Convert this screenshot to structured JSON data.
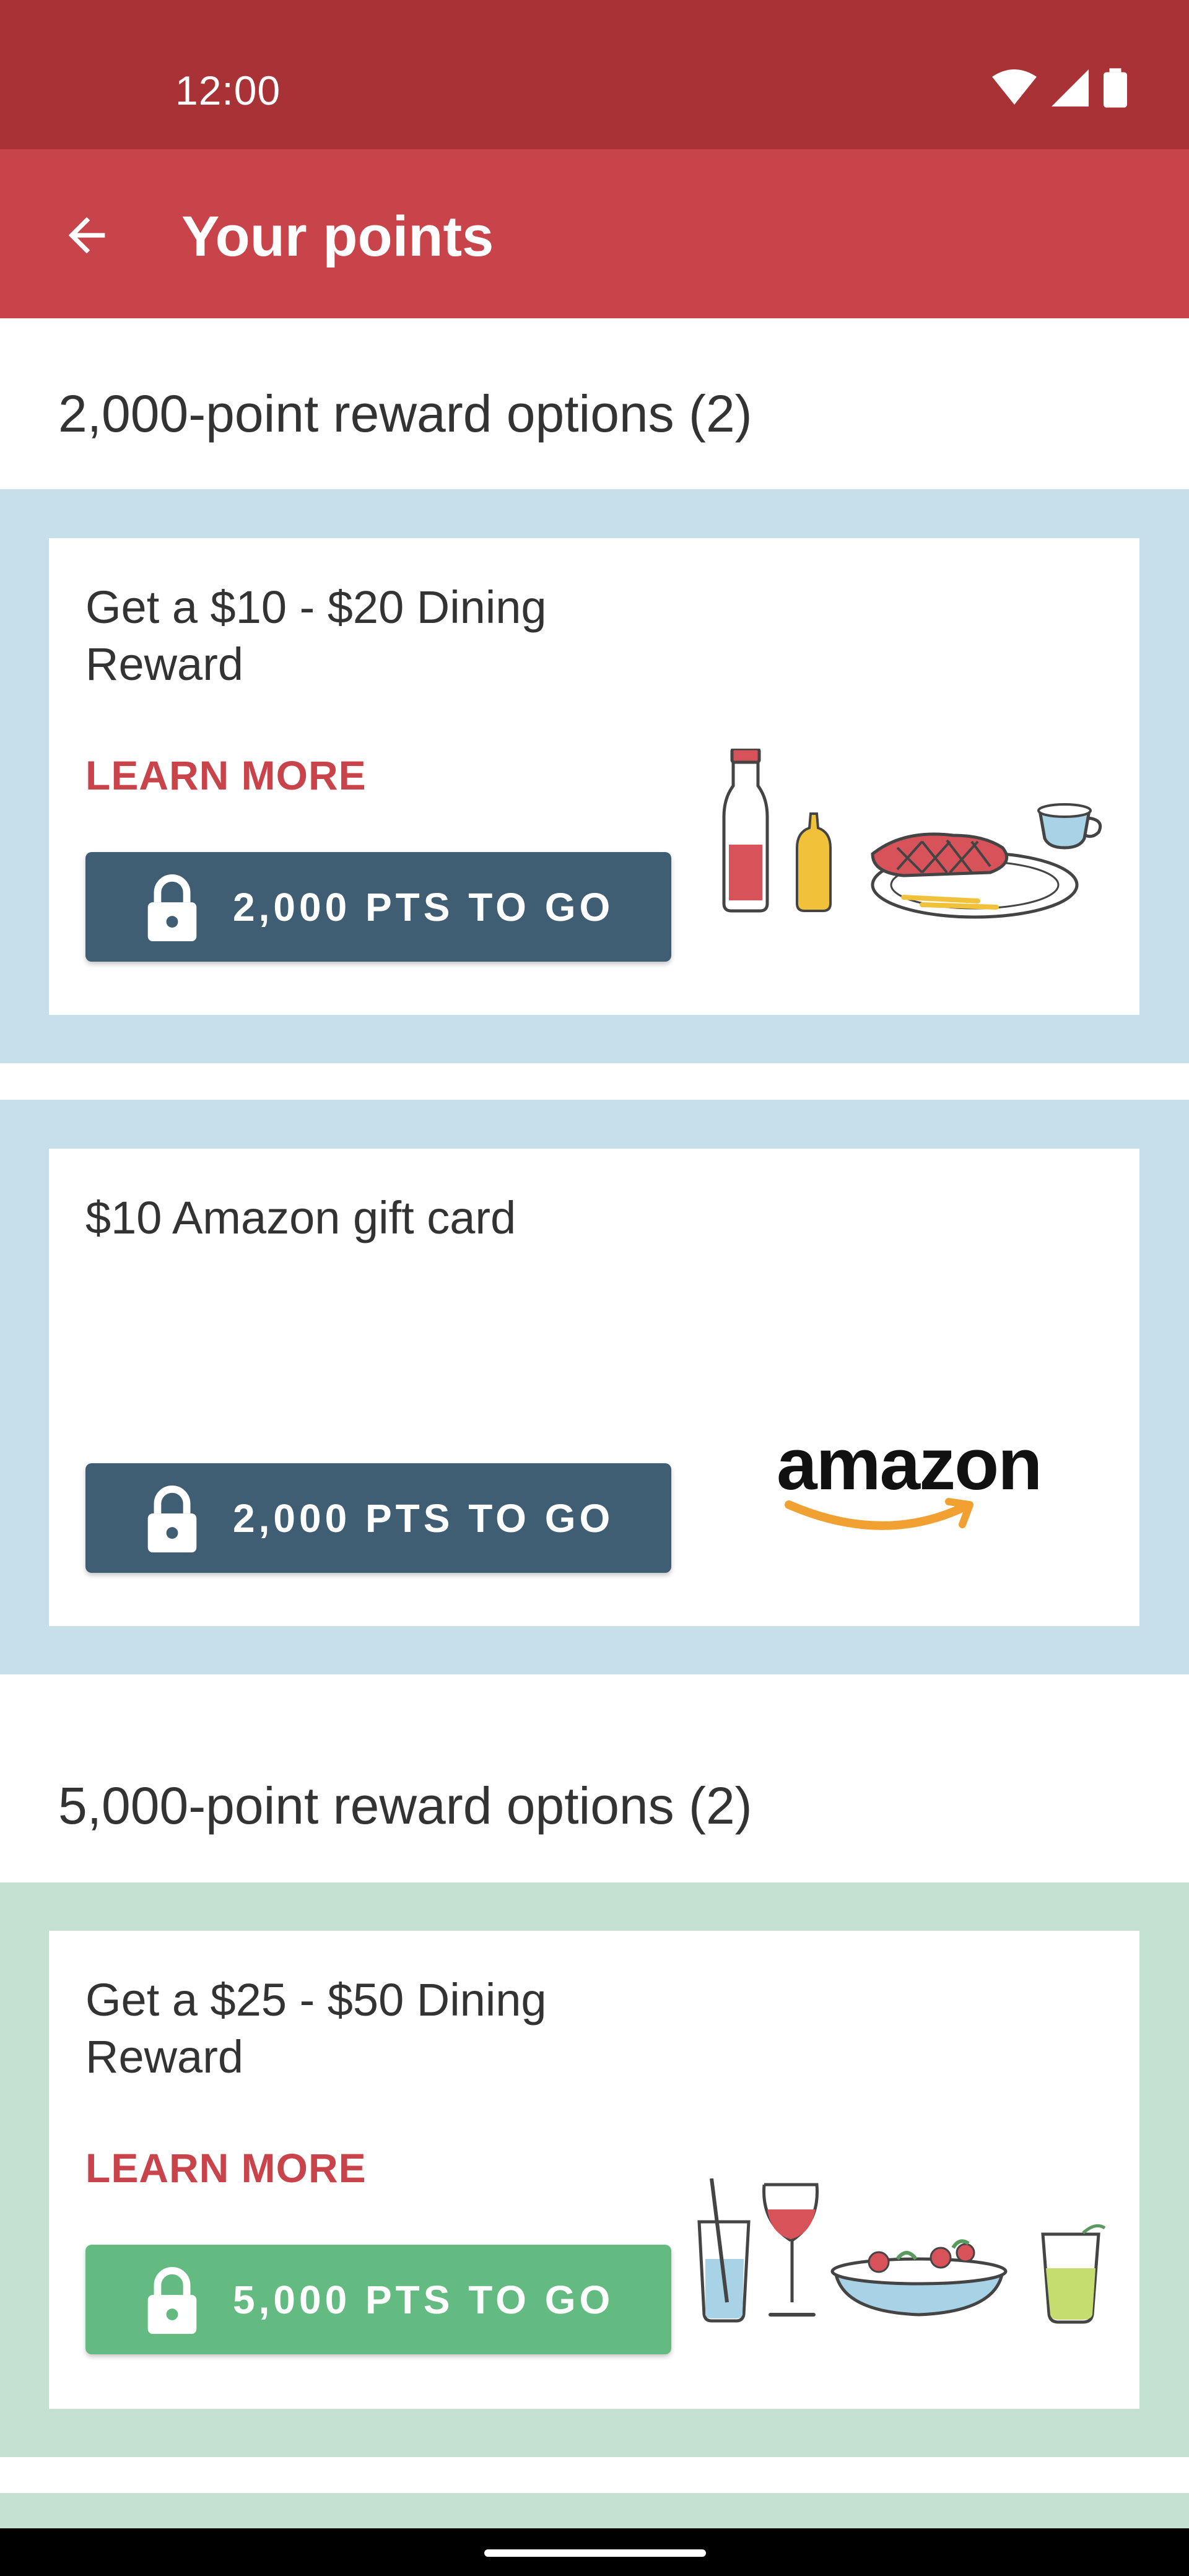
{
  "status_bar": {
    "time": "12:00"
  },
  "app_bar": {
    "title": "Your points"
  },
  "sections": [
    {
      "title": "2,000-point reward options (2)",
      "cards": [
        {
          "title": "Get a $10 - $20 Dining Reward",
          "learn_more": "LEARN MORE",
          "button": "2,000 PTS TO GO",
          "illustration": "dining-meal-illustration"
        },
        {
          "title": "$10 Amazon gift card",
          "button": "2,000 PTS TO GO",
          "logo_text": "amazon"
        }
      ]
    },
    {
      "title": "5,000-point reward options (2)",
      "cards": [
        {
          "title": "Get a $25 - $50 Dining Reward",
          "learn_more": "LEARN MORE",
          "button": "5,000 PTS TO GO",
          "illustration": "salad-drinks-illustration"
        }
      ]
    }
  ],
  "colors": {
    "status_bar": "#a83235",
    "app_bar": "#c8444a",
    "band_blue": "#c6dfea",
    "band_green": "#c3e2d1",
    "button_slate": "#3f5d73",
    "button_green": "#64bb82",
    "accent_red": "#c8444a"
  }
}
